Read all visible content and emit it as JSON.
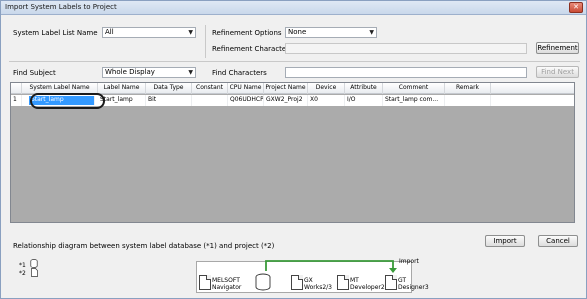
{
  "window": {
    "title": "Import System Labels to Project",
    "close_glyph": "✕"
  },
  "filter": {
    "system_label_list_label": "System Label List Name",
    "system_label_list_value": "All",
    "refinement_options_label": "Refinement Options",
    "refinement_options_value": "None",
    "refinement_characters_label": "Refinement Characters",
    "refinement_button": "Refinement"
  },
  "find": {
    "subject_label": "Find Subject",
    "subject_value": "Whole Display",
    "characters_label": "Find Characters",
    "next_button": "Find Next"
  },
  "table": {
    "columns": [
      "System Label Name",
      "Label Name",
      "Data Type",
      "Constant",
      "CPU Name",
      "Project Name",
      "Device",
      "Attribute",
      "Comment",
      "Remark"
    ],
    "rows": [
      {
        "index": "1",
        "cells": [
          "Start_lamp",
          "Start_lamp",
          "Bit",
          "",
          "Q06UDHCPU",
          "GXW2_Proj2",
          "X0",
          "I/O",
          "Start_lamp com...",
          ""
        ]
      }
    ]
  },
  "diagram": {
    "caption": "Relationship diagram between system label database (*1) and project (*2)",
    "legend1": "*1",
    "legend2": "*2",
    "import_label": "Import",
    "nodes": [
      {
        "line1": "MELSOFT",
        "line2": "Navigator"
      },
      {
        "line1": "GX",
        "line2": "Works2/3"
      },
      {
        "line1": "MT",
        "line2": "Developer2"
      },
      {
        "line1": "GT",
        "line2": "Designer3"
      }
    ]
  },
  "buttons": {
    "import": "Import",
    "cancel": "Cancel"
  },
  "colors": {
    "selection": "#3399ff",
    "arrow": "#3a9a3a",
    "title_bar": "#c9d8eb"
  }
}
